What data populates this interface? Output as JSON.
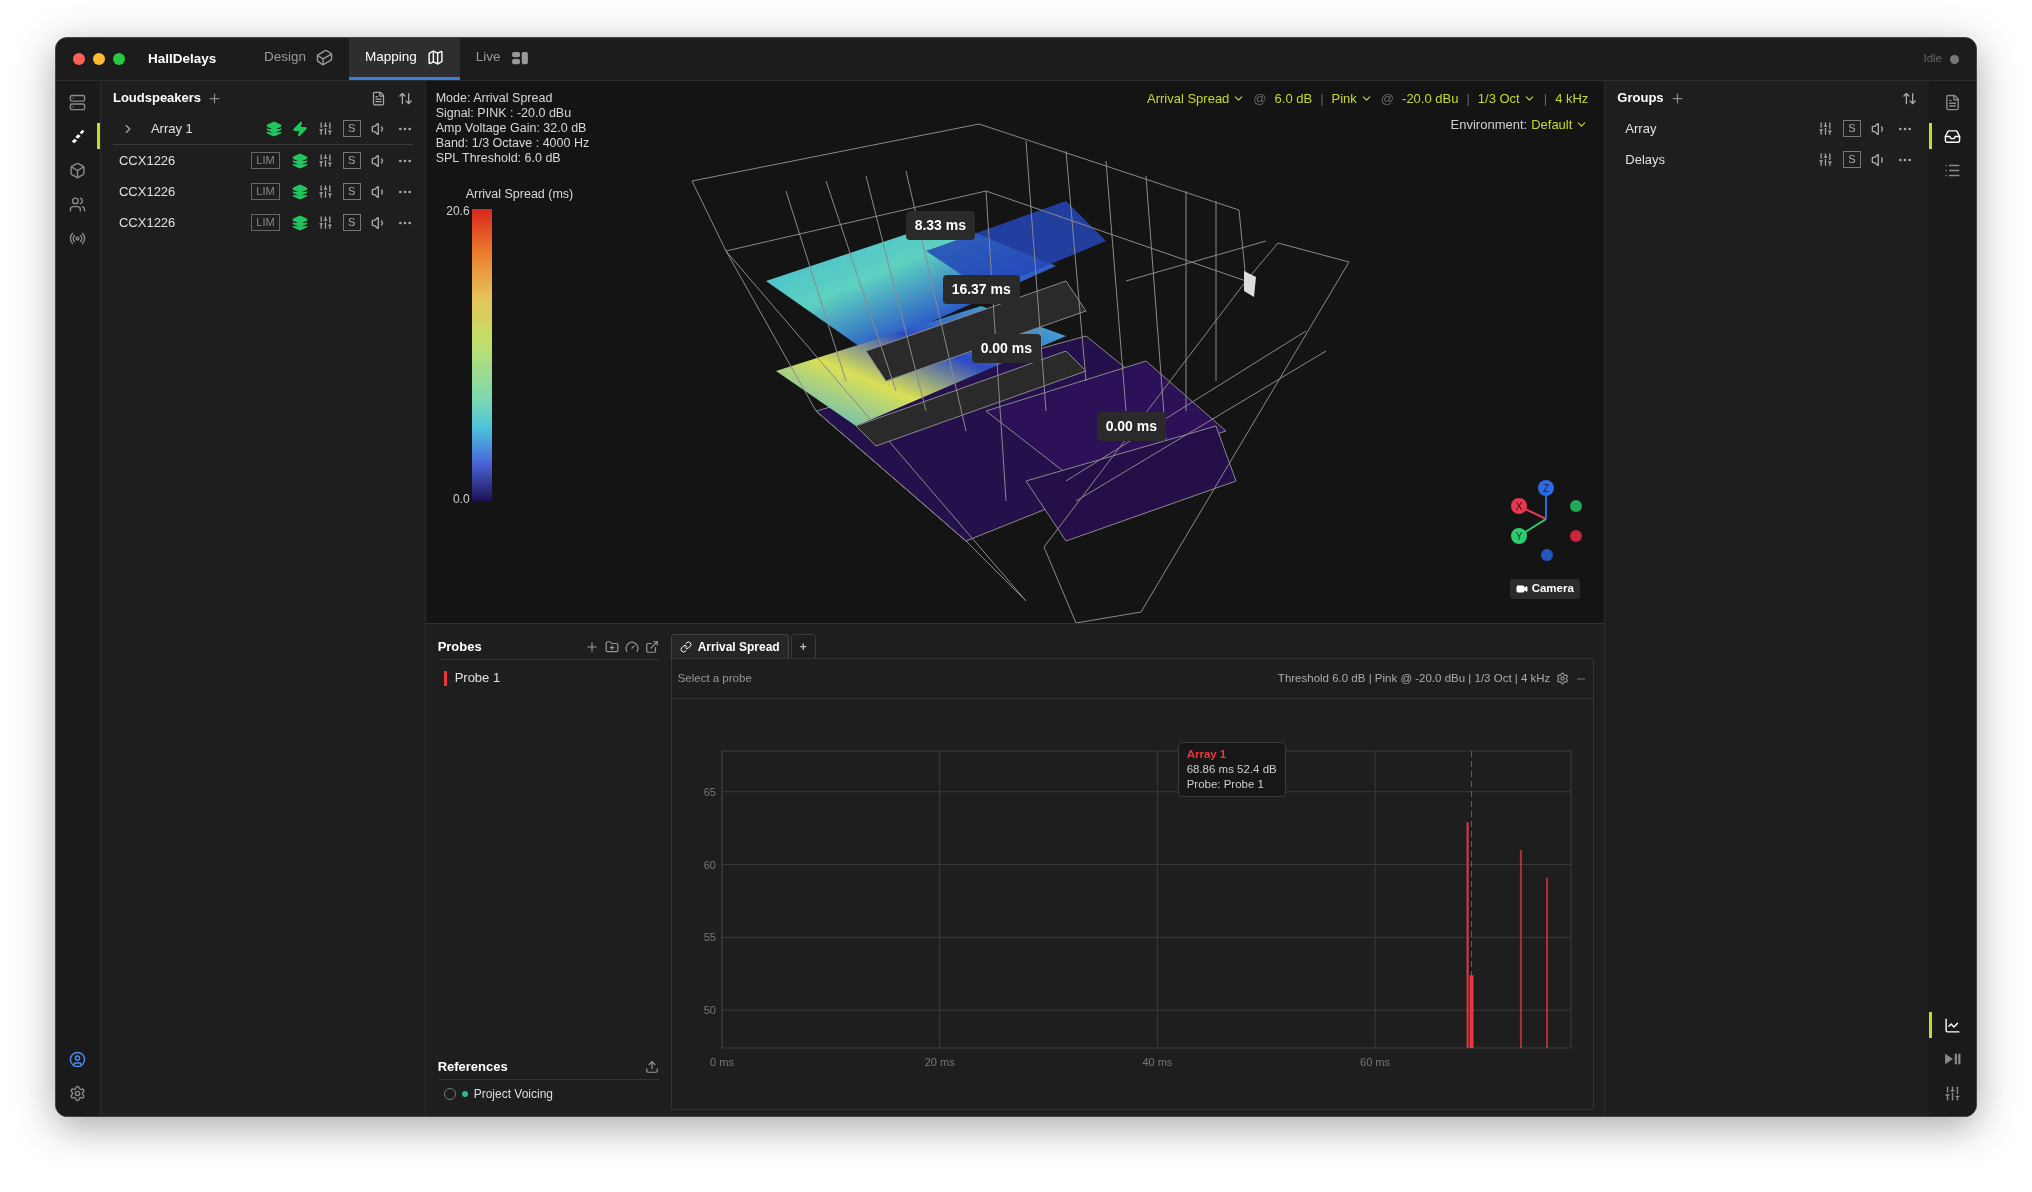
{
  "window": {
    "title": "HallDelays",
    "status": "Idle"
  },
  "tabs": [
    {
      "label": "Design",
      "selected": false
    },
    {
      "label": "Mapping",
      "selected": true
    },
    {
      "label": "Live",
      "selected": false
    }
  ],
  "left_rail": {
    "top": [
      {
        "selected": false
      },
      {
        "selected": true
      },
      {
        "selected": false
      },
      {
        "selected": false
      },
      {
        "selected": false
      }
    ],
    "bottom": [
      {
        "selected": false
      },
      {
        "selected": false
      }
    ]
  },
  "loudspeakers": {
    "title": "Loudspeakers",
    "items": [
      {
        "kind": "array",
        "name": "Array 1",
        "expanded": false,
        "solo_label": "S"
      },
      {
        "kind": "speaker",
        "name": "CCX1226",
        "limiter": "LIM",
        "solo_label": "S"
      },
      {
        "kind": "speaker",
        "name": "CCX1226",
        "limiter": "LIM",
        "solo_label": "S"
      },
      {
        "kind": "speaker",
        "name": "CCX1226",
        "limiter": "LIM",
        "solo_label": "S"
      }
    ]
  },
  "viewport": {
    "info": [
      "Mode: Arrival Spread",
      "Signal: PINK : -20.0 dBu",
      "Amp Voltage Gain: 32.0 dB",
      "Band: 1/3 Octave : 4000 Hz",
      "SPL Threshold: 6.0 dB"
    ],
    "legend": {
      "title": "Arrival Spread (ms)",
      "max": "20.6",
      "min": "0.0"
    },
    "controls": [
      {
        "kind": "dropdown",
        "text": "Arrival Spread"
      },
      {
        "kind": "symbol",
        "text": "@"
      },
      {
        "kind": "value",
        "text": "6.0 dB"
      },
      {
        "kind": "symbol",
        "text": "|"
      },
      {
        "kind": "dropdown",
        "text": "Pink"
      },
      {
        "kind": "symbol",
        "text": "@"
      },
      {
        "kind": "value",
        "text": "-20.0 dBu"
      },
      {
        "kind": "symbol",
        "text": "|"
      },
      {
        "kind": "dropdown",
        "text": "1/3 Oct"
      },
      {
        "kind": "symbol",
        "text": "|"
      },
      {
        "kind": "value",
        "text": "4 kHz"
      }
    ],
    "environment": {
      "label": "Environment:",
      "value": "Default"
    },
    "markers": [
      "8.33 ms",
      "16.37 ms",
      "0.00 ms",
      "0.00 ms"
    ],
    "gizmo": {
      "labels": [
        "X",
        "Y",
        "Z"
      ]
    },
    "camera_button": "Camera"
  },
  "probes": {
    "title": "Probes",
    "items": [
      {
        "name": "Probe 1",
        "color": "#e8383d"
      }
    ]
  },
  "references": {
    "title": "References",
    "items": [
      {
        "name": "Project Voicing",
        "checked": false,
        "color": "#2bb5a0"
      }
    ]
  },
  "chart_panel": {
    "tabs": [
      {
        "label": "Arrival Spread",
        "selected": true
      },
      {
        "label": "+",
        "selected": false
      }
    ],
    "hint": "Select a probe",
    "summary": "Threshold 6.0 dB | Pink @ -20.0 dBu | 1/3 Oct | 4 kHz",
    "tooltip": {
      "lines": [
        "68.86 ms 52.4 dB",
        "Probe: Probe 1"
      ]
    },
    "chart_data": {
      "type": "bar",
      "x": [
        68.5,
        68.86,
        73.4,
        75.8
      ],
      "series": [
        {
          "name": "Array 1",
          "color": "#e8383d",
          "values": [
            62.9,
            52.4,
            61.0,
            59.1
          ]
        }
      ],
      "xlim": [
        0,
        78
      ],
      "ylim": [
        47.4,
        67.8
      ],
      "xticks": [
        {
          "value": 0,
          "label": "0 ms"
        },
        {
          "value": 20,
          "label": "20 ms"
        },
        {
          "value": 40,
          "label": "40 ms"
        },
        {
          "value": 60,
          "label": "60 ms"
        }
      ],
      "yticks": [
        50,
        55,
        60,
        65
      ],
      "grid": true,
      "ref_lines": [
        {
          "axis": "x",
          "value": 68.86
        }
      ]
    }
  },
  "groups": {
    "title": "Groups",
    "items": [
      {
        "name": "Array",
        "solo_label": "S"
      },
      {
        "name": "Delays",
        "solo_label": "S"
      }
    ]
  },
  "right_rail": {
    "top": [
      {
        "selected": false
      },
      {
        "selected": true
      },
      {
        "selected": false
      }
    ],
    "bottom": [
      {
        "selected": true
      },
      {
        "selected": false
      },
      {
        "selected": false
      }
    ]
  }
}
